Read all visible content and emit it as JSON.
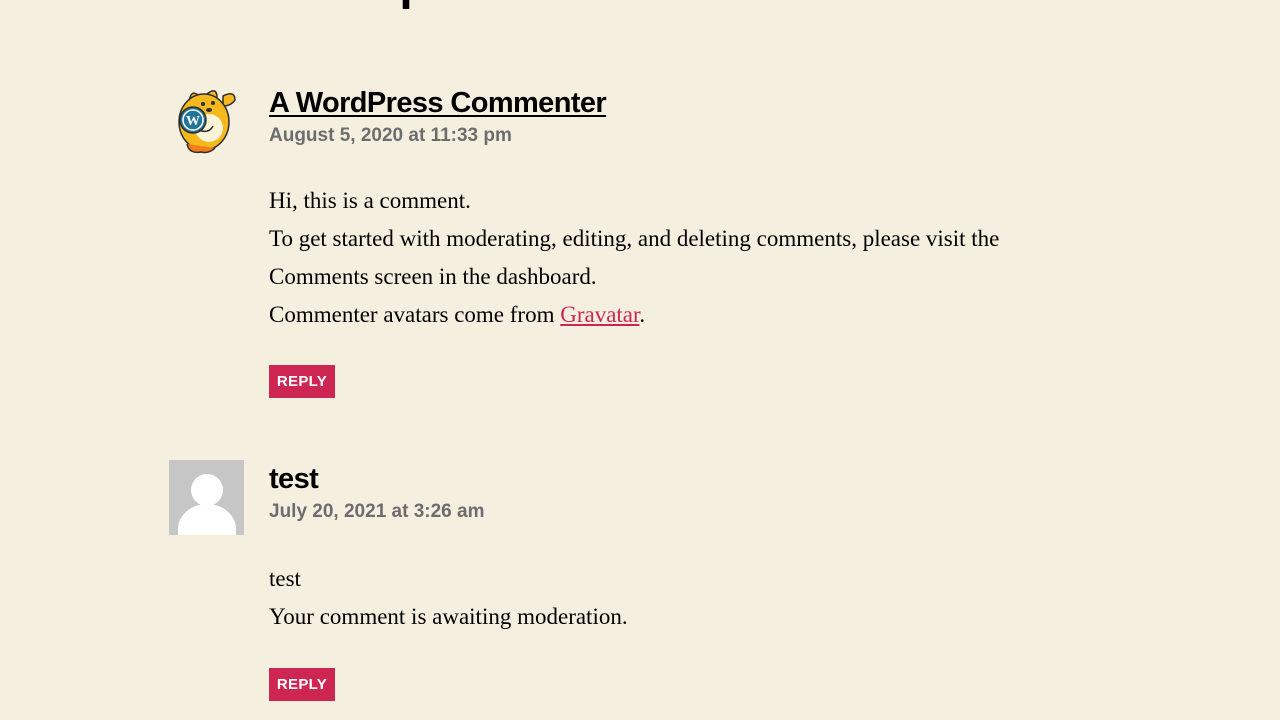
{
  "page": {
    "heading": "Replies"
  },
  "comments": [
    {
      "author": "A WordPress Commenter",
      "author_is_link": true,
      "avatar": "wapuu-icon",
      "date": "August 5, 2020 at 11:33 pm",
      "lines": [
        "Hi, this is a comment.",
        "To get started with moderating, editing, and deleting comments, please visit the Comments screen in the dashboard."
      ],
      "last_line_prefix": "Commenter avatars come from ",
      "last_line_link": "Gravatar",
      "last_line_suffix": ".",
      "reply_label": "REPLY"
    },
    {
      "author": "test",
      "author_is_link": false,
      "avatar": "default-avatar-icon",
      "date": "July 20, 2021 at 3:26 am",
      "lines": [
        "test",
        "Your comment is awaiting moderation."
      ],
      "reply_label": "REPLY"
    }
  ],
  "colors": {
    "background": "#f5efe0",
    "accent": "#cd2653",
    "meta_text": "#6d6d6d"
  }
}
